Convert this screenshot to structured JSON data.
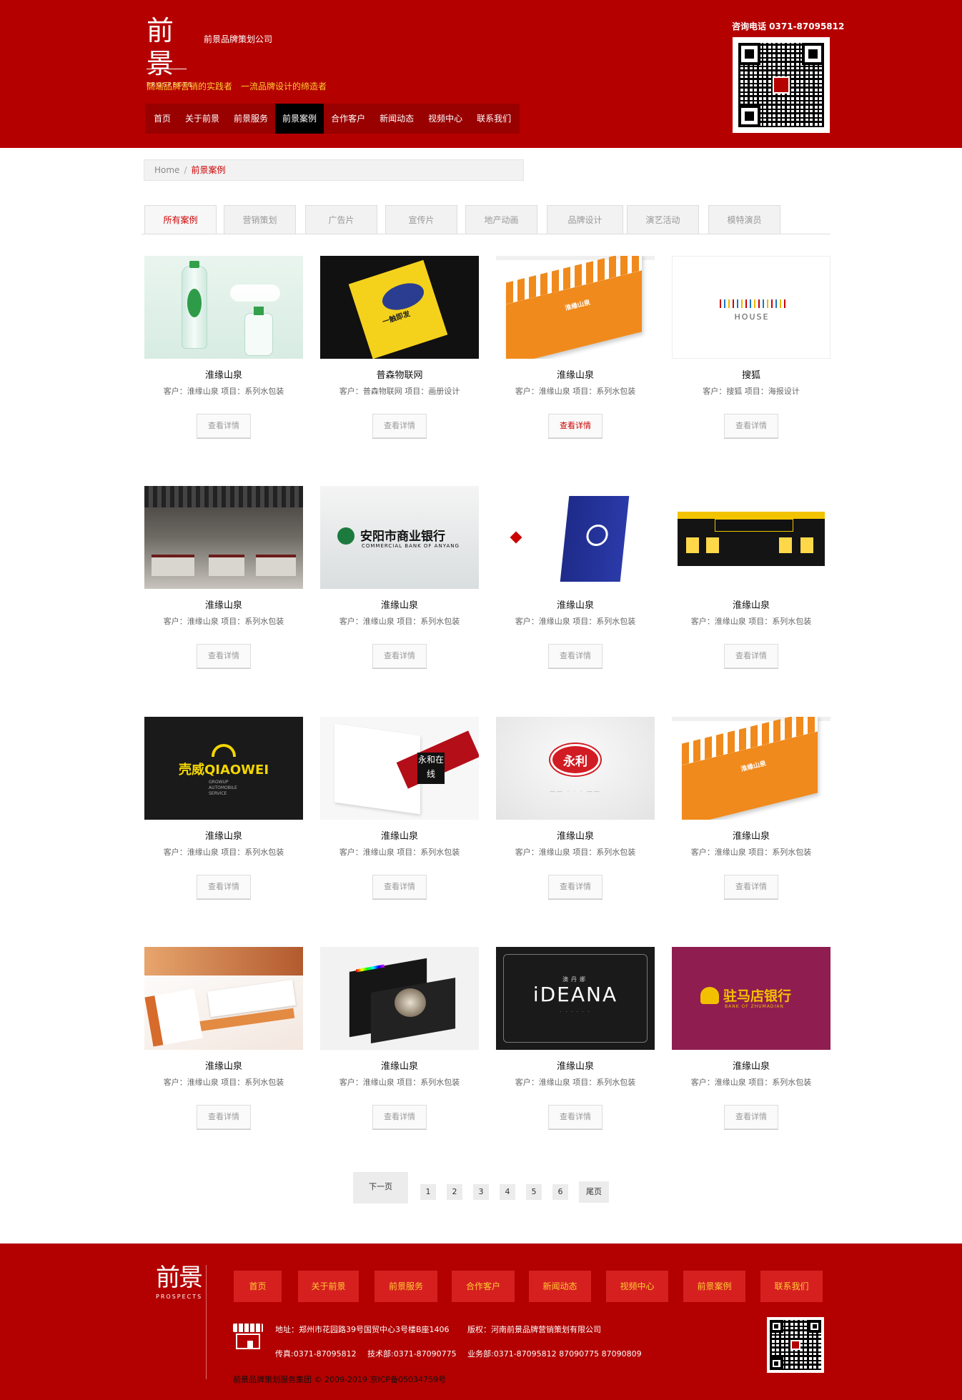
{
  "header": {
    "logo_glyph": "前景",
    "logo_sub": "PROSPECTS",
    "company_name": "前景品牌策划公司",
    "slogan": "高端品牌营销的实践者　一流品牌设计的缔造者",
    "hotline": "咨询电话  0371-87095812",
    "nav": [
      "首页",
      "关于前景",
      "前景服务",
      "前景案例",
      "合作客户",
      "新闻动态",
      "视频中心",
      "联系我们"
    ],
    "nav_active": "前景案例"
  },
  "breadcrumb": {
    "home": "Home",
    "sep": "/",
    "current": "前景案例"
  },
  "tabs": [
    "所有案例",
    "营销策划",
    "广告片",
    "宣传片",
    "地产动画",
    "品牌设计",
    "演艺活动",
    "模特演员"
  ],
  "tabs_active": "所有案例",
  "cases": [
    {
      "title": "淮缘山泉",
      "meta": "客户：淮缘山泉 项目：系列水包装",
      "button": "查看详情",
      "art": "water"
    },
    {
      "title": "普森物联网",
      "meta": "客户：普森物联网 项目：画册设计",
      "button": "查看详情",
      "art": "mouse"
    },
    {
      "title": "淮缘山泉",
      "meta": "客户：淮缘山泉 项目：系列水包装",
      "button": "查看详情",
      "art": "orange",
      "active": true
    },
    {
      "title": "搜狐",
      "meta": "客户：搜狐 项目：海报设计",
      "button": "查看详情",
      "art": "house"
    },
    {
      "title": "淮缘山泉",
      "meta": "客户：淮缘山泉 项目：系列水包装",
      "button": "查看详情",
      "art": "showroom"
    },
    {
      "title": "淮缘山泉",
      "meta": "客户：淮缘山泉 项目：系列水包装",
      "button": "查看详情",
      "art": "bank"
    },
    {
      "title": "淮缘山泉",
      "meta": "客户：淮缘山泉 项目：系列水包装",
      "button": "查看详情",
      "art": "nvc"
    },
    {
      "title": "淮缘山泉",
      "meta": "客户：淮缘山泉 项目：系列水包装",
      "button": "查看详情",
      "art": "store"
    },
    {
      "title": "淮缘山泉",
      "meta": "客户：淮缘山泉 项目：系列水包装",
      "button": "查看详情",
      "art": "qiaowei"
    },
    {
      "title": "淮缘山泉",
      "meta": "客户：淮缘山泉 项目：系列水包装",
      "button": "查看详情",
      "art": "yonghe"
    },
    {
      "title": "淮缘山泉",
      "meta": "客户：淮缘山泉 项目：系列水包装",
      "button": "查看详情",
      "art": "yongli"
    },
    {
      "title": "淮缘山泉",
      "meta": "客户：淮缘山泉 项目：系列水包装",
      "button": "查看详情",
      "art": "orange"
    },
    {
      "title": "淮缘山泉",
      "meta": "客户：淮缘山泉 项目：系列水包装",
      "button": "查看详情",
      "art": "cards"
    },
    {
      "title": "淮缘山泉",
      "meta": "客户：淮缘山泉 项目：系列水包装",
      "button": "查看详情",
      "art": "book"
    },
    {
      "title": "淮缘山泉",
      "meta": "客户：淮缘山泉 项目：系列水包装",
      "button": "查看详情",
      "art": "ideana"
    },
    {
      "title": "淮缘山泉",
      "meta": "客户：淮缘山泉 项目：系列水包装",
      "button": "查看详情",
      "art": "zhumadian"
    }
  ],
  "thumb_text": {
    "mouse": "一触即发",
    "orange": "淮缘山泉",
    "house": "HOUSE",
    "bank_cn": "安阳市商业银行",
    "bank_en": "COMMERCIAL BANK OF ANYANG",
    "qiaowei": "壳威QIAOWEI",
    "yonghe": "永和在线",
    "yongli": "永利",
    "ideana_cn": "澳丹娜",
    "ideana": "iDEANA",
    "zhumadian_cn": "驻马店银行",
    "zhumadian_en": "BANK OF ZHUMADIAN"
  },
  "pagination": {
    "next": "下一页",
    "pages": [
      "1",
      "2",
      "3",
      "4",
      "5",
      "6"
    ],
    "last": "尾页"
  },
  "footer": {
    "nav": [
      "首页",
      "关于前景",
      "前景服务",
      "合作客户",
      "新闻动态",
      "视频中心",
      "前景案例",
      "联系我们"
    ],
    "address": "地址：郑州市花园路39号国贸中心3号楼B座1406",
    "copyright": "版权：河南前景品牌营销策划有限公司",
    "fax": "传真:0371-87095812",
    "tech": "技术部:0371-87090775",
    "biz": "业务部:0371-87095812 87090775 87090809",
    "icp": "前景品牌策划服务集团 © 2009-2019  京ICP备05034759号"
  },
  "colors": {
    "brand_red": "#b50000",
    "accent_yellow": "#ffcc33",
    "nav_active_bg": "#000000"
  }
}
